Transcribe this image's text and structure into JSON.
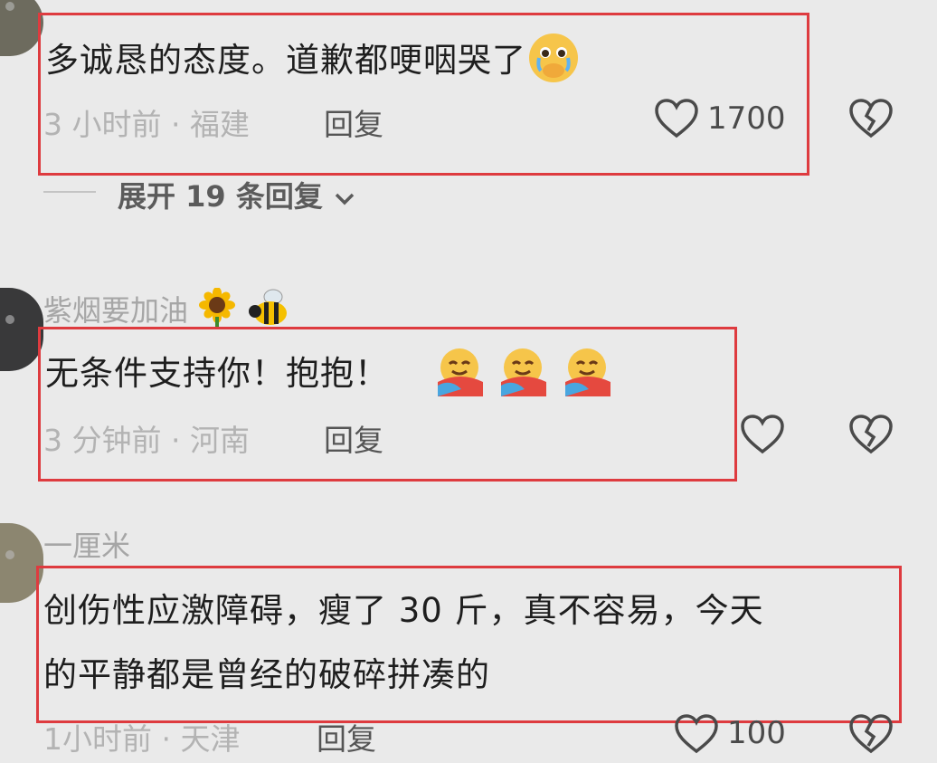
{
  "comments": [
    {
      "text": "多诚恳的态度。道歉都哽咽哭了",
      "emoji": "cry-face",
      "time_location": "3 小时前 · 福建",
      "reply_label": "回复",
      "like_count": "1700",
      "expand_label": "展开 19 条回复"
    },
    {
      "username": "紫烟要加油",
      "username_emojis": [
        "sunflower",
        "bee"
      ],
      "text": "无条件支持你！抱抱！",
      "emojis": [
        "hug-face",
        "hug-face",
        "hug-face"
      ],
      "time_location": "3 分钟前 · 河南",
      "reply_label": "回复"
    },
    {
      "username": "一厘米",
      "text_line1": "创伤性应激障碍，瘦了 30 斤，真不容易，今天",
      "text_line2": "的平静都是曾经的破碎拼凑的",
      "time_location": "1小时前 · 天津",
      "reply_label": "回复",
      "like_count": "100"
    }
  ],
  "colors": {
    "background": "#eaeaea",
    "highlight_border": "#de3b3f",
    "meta_text": "#b3b3b3",
    "comment_text": "#1e1e1e"
  },
  "icons": [
    "heart-outline-icon",
    "broken-heart-icon",
    "chevron-down-icon"
  ]
}
